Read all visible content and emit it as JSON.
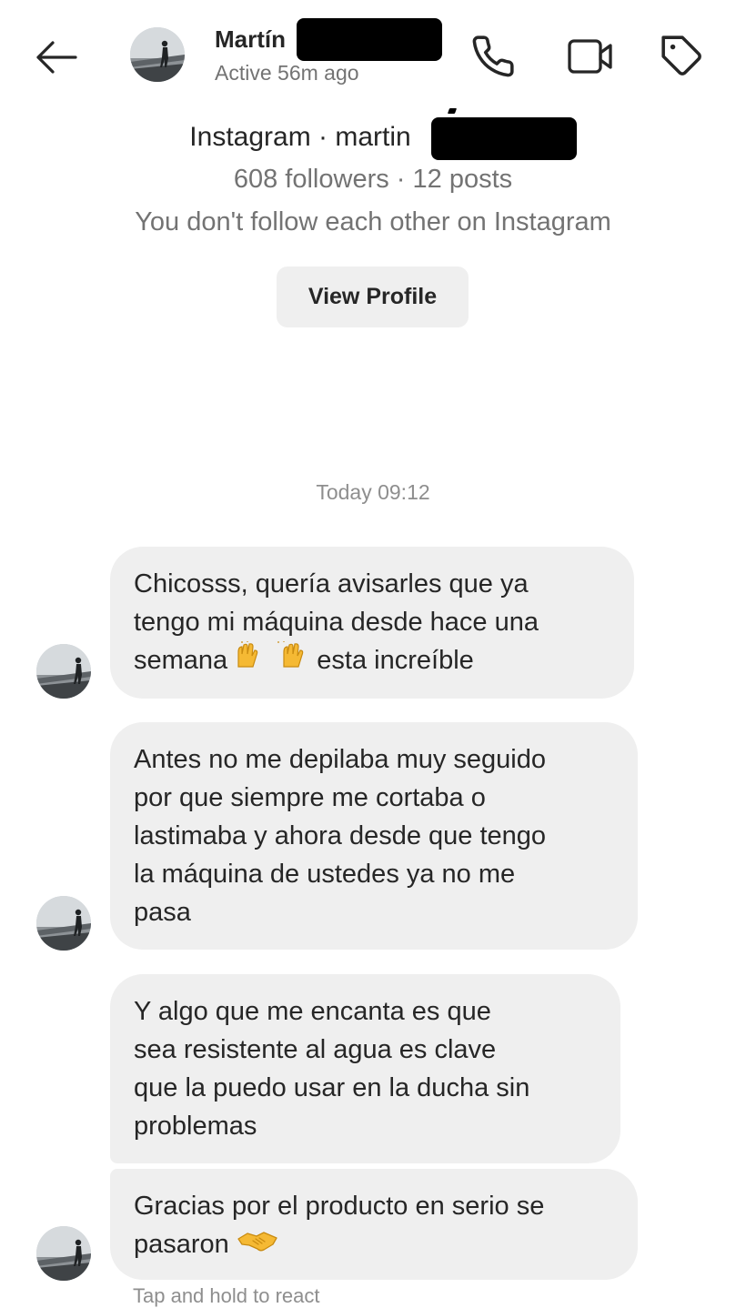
{
  "header": {
    "contact_name": "Martín",
    "active_status": "Active 56m ago",
    "icons": {
      "back": "back-arrow-icon",
      "call": "phone-icon",
      "video": "video-camera-icon",
      "tag": "tag-icon"
    }
  },
  "profile": {
    "platform_line": "Instagram · martin",
    "stats": "608 followers · 12 posts",
    "follow_status": "You don't follow each other on Instagram",
    "view_profile_label": "View Profile"
  },
  "conversation": {
    "timestamp": "Today 09:12",
    "messages": [
      {
        "lines": [
          "Chicosss, quería avisarles que ya",
          "tengo mi máquina desde hace una",
          "semana",
          "esta increíble"
        ],
        "emoji": "raising-hands-emoji"
      },
      {
        "lines": [
          "Antes no me depilaba muy seguido",
          "por que siempre me cortaba o",
          "lastimaba y ahora desde que tengo",
          "la máquina de ustedes ya no me",
          "pasa"
        ]
      },
      {
        "lines": [
          "Y algo que me encanta es que",
          "sea resistente al agua es clave",
          "que la puedo usar en la ducha sin",
          "problemas"
        ]
      },
      {
        "lines": [
          "Gracias por el producto en serio se",
          "pasaron"
        ],
        "emoji": "handshake-emoji"
      }
    ],
    "footer_partial": "Tap and hold to react"
  },
  "colors": {
    "bubble": "#efefef",
    "text_primary": "#262626",
    "text_secondary": "#737373",
    "redaction": "#000000"
  }
}
